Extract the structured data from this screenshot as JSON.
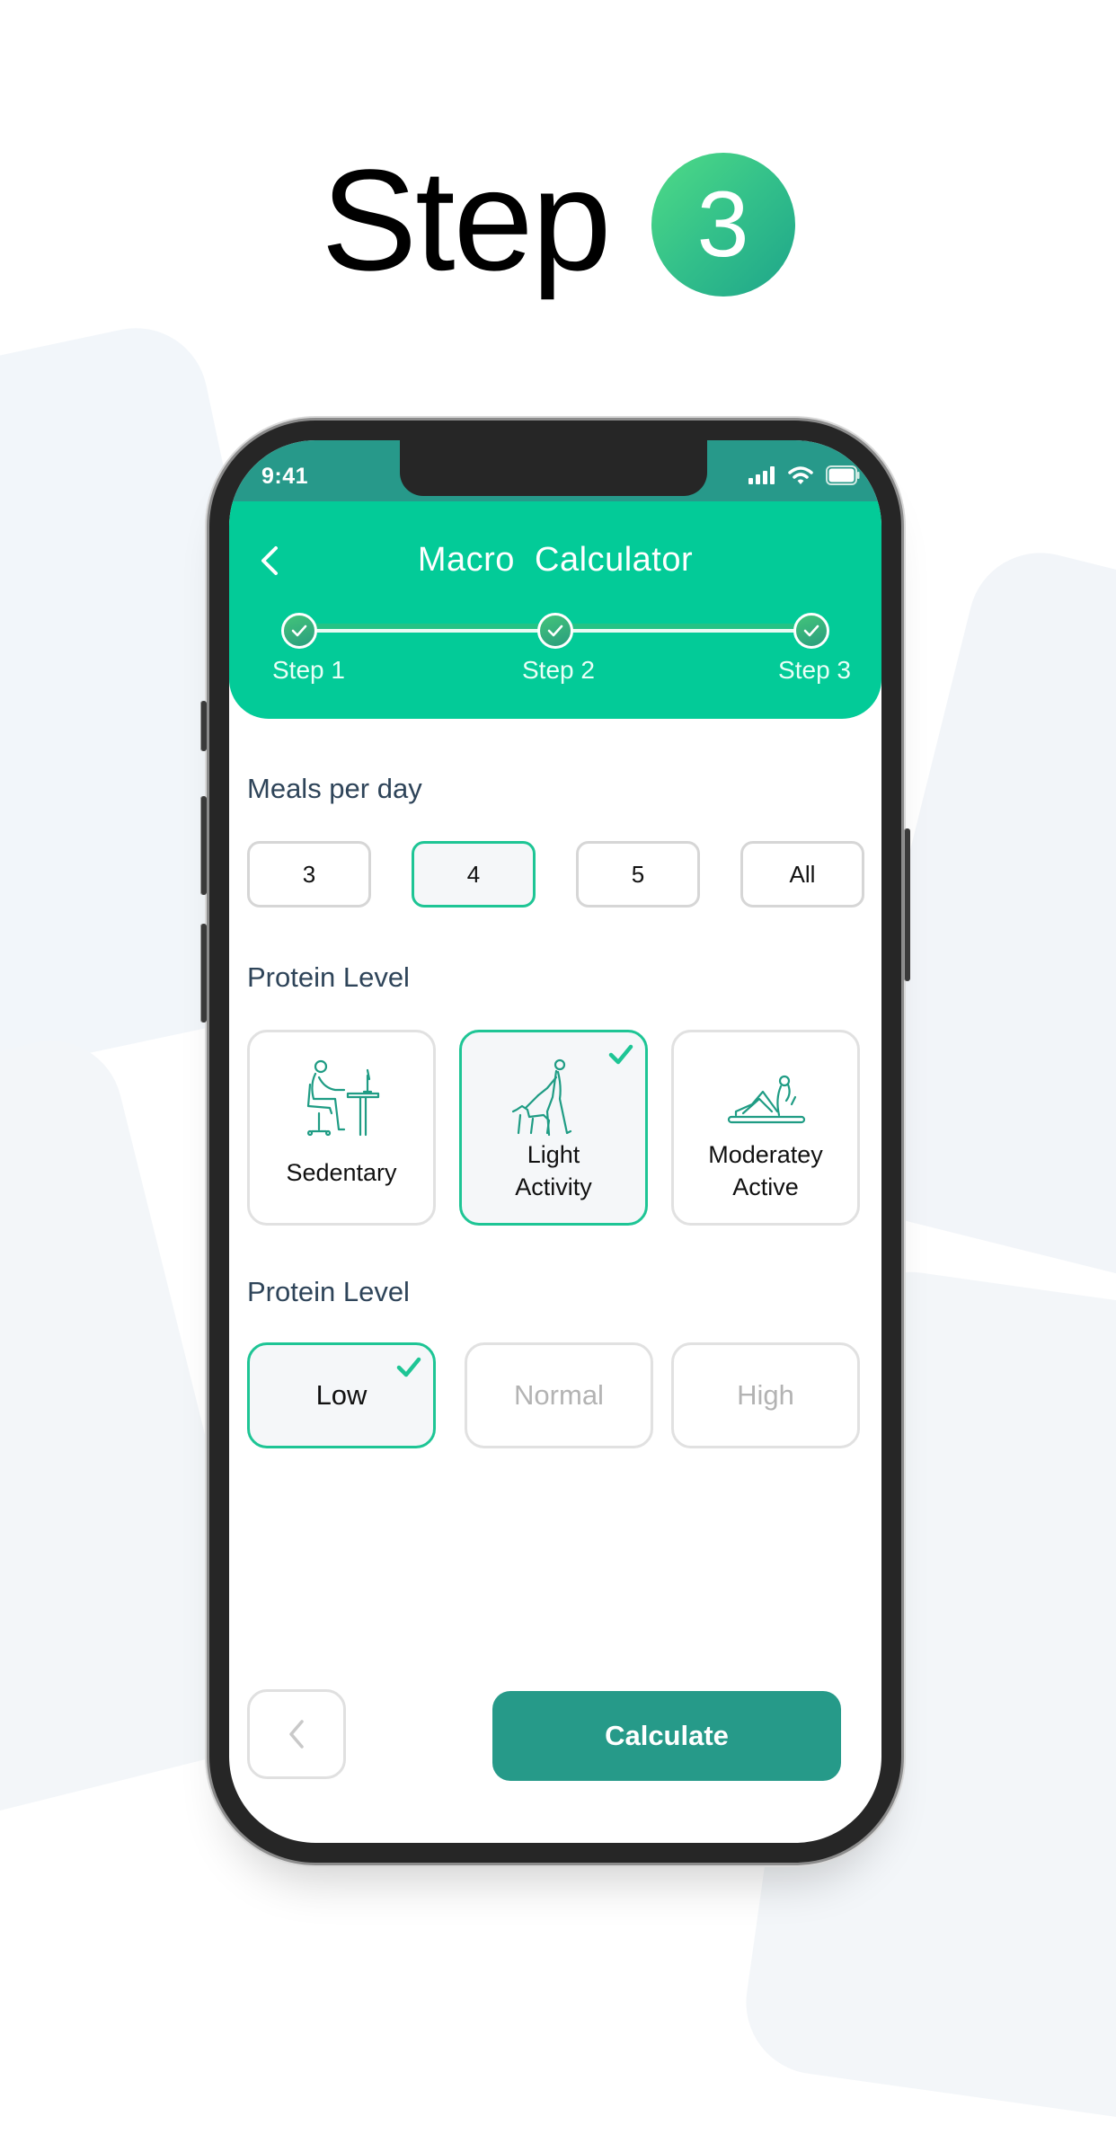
{
  "hero": {
    "title": "Step",
    "badge": "3",
    "badge_colors": [
      "#4fdb86",
      "#1ea58a"
    ]
  },
  "status_bar": {
    "time": "9:41",
    "icons": [
      "signal-icon",
      "wifi-icon",
      "battery-icon"
    ]
  },
  "header": {
    "title": "Macro  Calculator",
    "back_icon": "chevron-left-icon",
    "color": "#03cb98",
    "steps": [
      {
        "label": "Step 1",
        "completed": true
      },
      {
        "label": "Step 2",
        "completed": true
      },
      {
        "label": "Step 3",
        "completed": true
      }
    ]
  },
  "meals": {
    "label": "Meals per day",
    "options": [
      "3",
      "4",
      "5",
      "All"
    ],
    "selected": "4"
  },
  "activity": {
    "label": "Protein Level",
    "options": [
      {
        "label": "Sedentary",
        "icon": "person-at-desk-icon",
        "selected": false
      },
      {
        "label": "Light\nActivity",
        "line1": "Light",
        "line2": "Activity",
        "icon": "person-walking-dog-icon",
        "selected": true
      },
      {
        "label": "Moderatey\nActive",
        "line1": "Moderatey",
        "line2": "Active",
        "icon": "person-situp-exercise-icon",
        "selected": false
      }
    ]
  },
  "protein": {
    "label": "Protein Level",
    "options": [
      {
        "label": "Low",
        "selected": true
      },
      {
        "label": "Normal",
        "selected": false
      },
      {
        "label": "High",
        "selected": false
      }
    ]
  },
  "footer": {
    "back_icon": "chevron-left-icon",
    "calculate_label": "Calculate",
    "accent": "#269a89"
  }
}
